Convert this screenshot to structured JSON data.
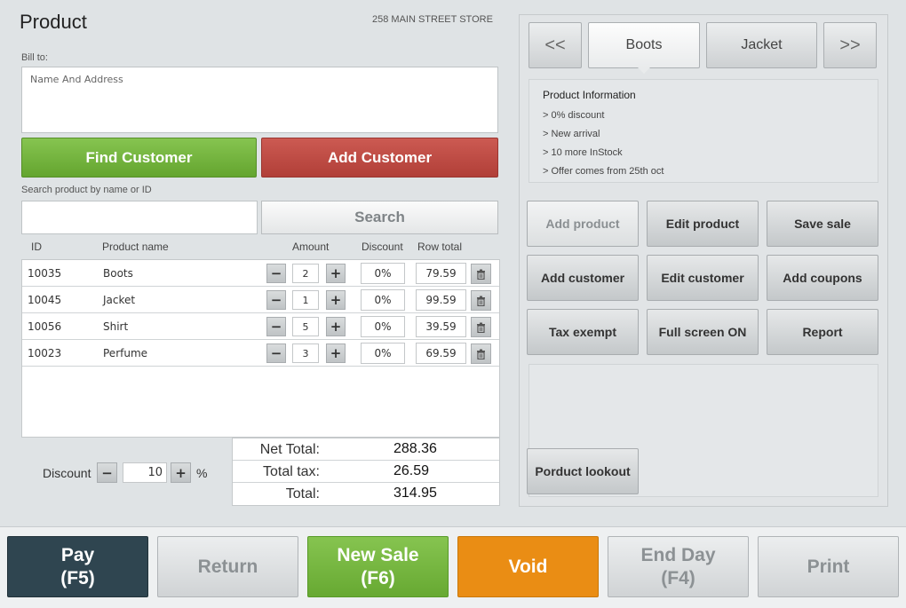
{
  "header": {
    "title": "Product",
    "store": "258 MAIN STREET STORE"
  },
  "bill_to": {
    "label": "Bill to:",
    "placeholder": "Name And Address"
  },
  "customer_buttons": {
    "find": "Find Customer",
    "add": "Add Customer"
  },
  "search": {
    "label": "Search product by name or ID",
    "value": "",
    "button": "Search"
  },
  "table": {
    "headers": {
      "id": "ID",
      "name": "Product name",
      "amount": "Amount",
      "discount": "Discount",
      "row_total": "Row total"
    },
    "rows": [
      {
        "id": "10035",
        "name": "Boots",
        "amount": "2",
        "discount": "0%",
        "total": "79.59"
      },
      {
        "id": "10045",
        "name": "Jacket",
        "amount": "1",
        "discount": "0%",
        "total": "99.59"
      },
      {
        "id": "10056",
        "name": "Shirt",
        "amount": "5",
        "discount": "0%",
        "total": "39.59"
      },
      {
        "id": "10023",
        "name": "Perfume",
        "amount": "3",
        "discount": "0%",
        "total": "69.59"
      }
    ]
  },
  "discount": {
    "label": "Discount",
    "value": "10",
    "unit": "%",
    "minus": "−",
    "plus": "+"
  },
  "totals": {
    "net_label": "Net Total:",
    "net": "288.36",
    "tax_label": "Total tax:",
    "tax": "26.59",
    "total_label": "Total:",
    "total": "314.95"
  },
  "product_nav": {
    "prev": "<<",
    "tab1": "Boots",
    "tab2": "Jacket",
    "next": ">>"
  },
  "product_info": {
    "title": "Product Information",
    "lines": [
      "> 0% discount",
      "> New arrival",
      "> 10 more InStock",
      "> Offer comes from 25th oct"
    ]
  },
  "actions": {
    "add_product": "Add product",
    "edit_product": "Edit product",
    "save_sale": "Save sale",
    "add_customer": "Add customer",
    "edit_customer": "Edit customer",
    "add_coupons": "Add coupons",
    "tax_exempt": "Tax exempt",
    "full_screen": "Full screen ON",
    "report": "Report",
    "lookup": "Porduct lookout"
  },
  "footer": {
    "pay": [
      "Pay",
      "(F5)"
    ],
    "return": "Return",
    "new_sale": [
      "New Sale",
      "(F6)"
    ],
    "void": "Void",
    "end_day": [
      "End Day",
      "(F4)"
    ],
    "print": "Print"
  },
  "colors": {
    "green": "#6fb03a",
    "red": "#bf4a43",
    "pay": "#2f4550",
    "void": "#ea8d14"
  }
}
